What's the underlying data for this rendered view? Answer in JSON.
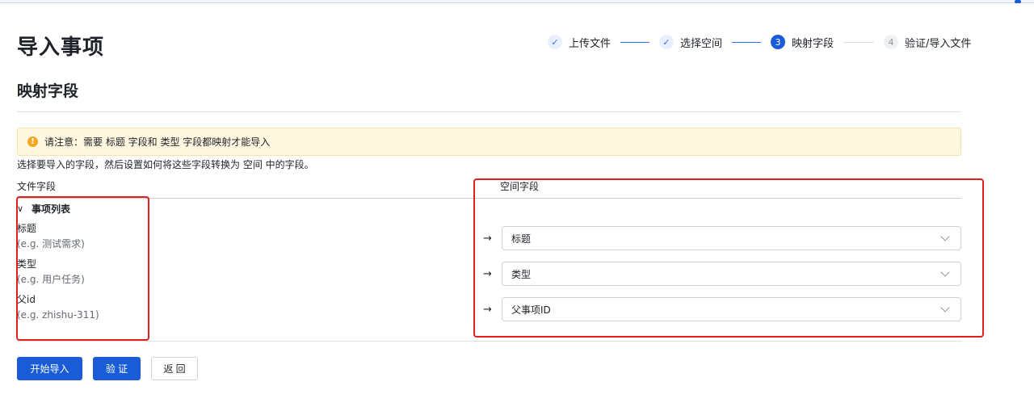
{
  "page": {
    "title": "导入事项"
  },
  "steps": [
    {
      "index": "1",
      "label": "上传文件",
      "status": "done"
    },
    {
      "index": "2",
      "label": "选择空间",
      "status": "done"
    },
    {
      "index": "3",
      "label": "映射字段",
      "status": "active"
    },
    {
      "index": "4",
      "label": "验证/导入文件",
      "status": "todo"
    }
  ],
  "section": {
    "title": "映射字段"
  },
  "notice": {
    "text": "请注意：需要 标题 字段和 类型 字段都映射才能导入",
    "icon": "warning-icon",
    "color": "#f5a623"
  },
  "description": "选择要导入的字段，然后设置如何将这些字段转换为 空间 中的字段。",
  "columns": {
    "left": "文件字段",
    "right": "空间字段"
  },
  "group": {
    "label": "事项列表"
  },
  "fields": [
    {
      "name": "标题",
      "example": "(e.g. 测试需求)",
      "mapped_to": "标题"
    },
    {
      "name": "类型",
      "example": "(e.g. 用户任务)",
      "mapped_to": "类型"
    },
    {
      "name": "父id",
      "example": "(e.g. zhishu-311)",
      "mapped_to": "父事项ID"
    }
  ],
  "buttons": {
    "start": "开始导入",
    "validate": "验 证",
    "back": "返 回"
  },
  "colors": {
    "primary": "#1a5bd8",
    "annotation": "#e02020",
    "notice_bg": "#fff7e0"
  }
}
